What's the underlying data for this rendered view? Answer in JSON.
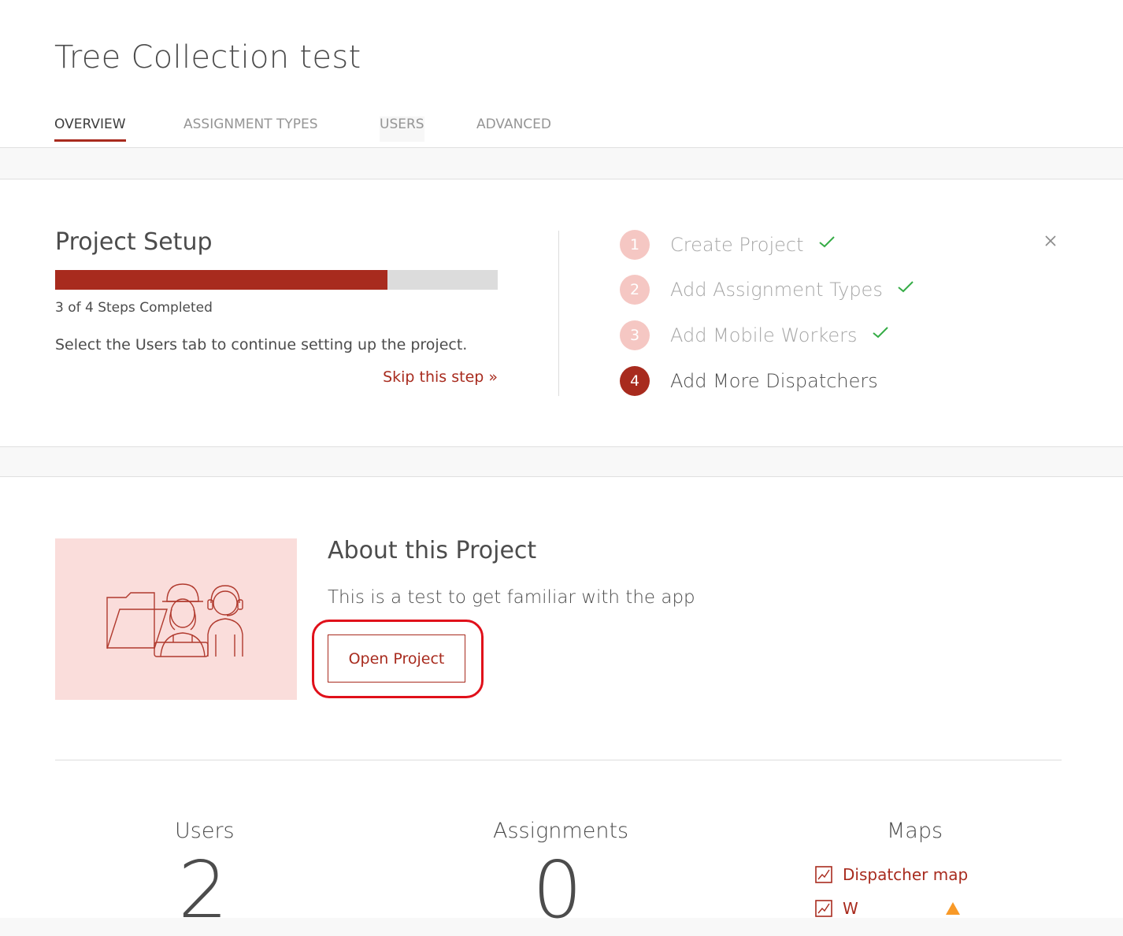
{
  "header": {
    "title": "Tree Collection test",
    "tabs": [
      {
        "label": "OVERVIEW",
        "active": true
      },
      {
        "label": "ASSIGNMENT TYPES",
        "active": false
      },
      {
        "label": "USERS",
        "active": false
      },
      {
        "label": "ADVANCED",
        "active": false
      }
    ]
  },
  "setup": {
    "title": "Project Setup",
    "progress_fraction": 0.75,
    "steps_completed_text": "3 of 4 Steps Completed",
    "instruction": "Select the Users tab to continue setting up the project.",
    "skip_label": "Skip this step »",
    "close_icon": "close-icon",
    "steps": [
      {
        "number": "1",
        "label": "Create Project",
        "done": true
      },
      {
        "number": "2",
        "label": "Add Assignment Types",
        "done": true
      },
      {
        "number": "3",
        "label": "Add Mobile Workers",
        "done": true
      },
      {
        "number": "4",
        "label": "Add More Dispatchers",
        "done": false
      }
    ]
  },
  "about": {
    "title": "About this Project",
    "description": "This is a test to get familiar with the app",
    "open_button_label": "Open Project",
    "illustration_icon": "workers-illustration-icon"
  },
  "stats": {
    "users_label": "Users",
    "users_value": "2",
    "assignments_label": "Assignments",
    "assignments_value": "0",
    "maps_label": "Maps",
    "maps": [
      {
        "label": "Dispatcher map",
        "icon": "map-icon"
      },
      {
        "label": "W",
        "icon": "map-icon",
        "warning_icon": "warning-icon"
      }
    ]
  },
  "colors": {
    "accent": "#a82b1e",
    "step_done": "#f5c7c3",
    "check": "#35ac46",
    "illustration_bg": "#fadddb",
    "highlight": "#e0101a",
    "warning": "#f89927"
  }
}
